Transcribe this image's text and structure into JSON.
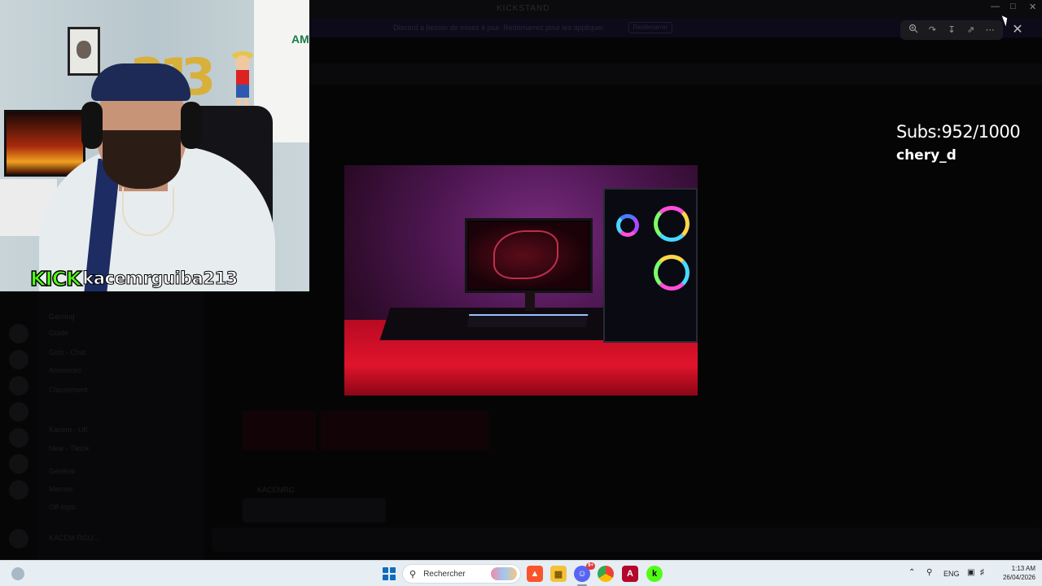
{
  "background_app": {
    "title": "KICKSTAND",
    "banner_text": "Discord a besoin de mises à jour. Redémarrez pour les appliquer.",
    "banner_button": "Redémarrer",
    "sidebar_rows": [
      "Gaming",
      "Guide",
      "Girls - Chat",
      "Annonces",
      "Classement",
      "Kacem - UK",
      "New - Tiktok",
      "Général",
      "Memes",
      "Off-topic"
    ],
    "user_tag": "KACEM RGU...",
    "message_author": "KACEMRG"
  },
  "webcam": {
    "platform_logo": "KICK",
    "username": "kacemrguiba213",
    "shirt_text": "AMA",
    "balloons": [
      "2",
      "1",
      "3"
    ]
  },
  "viewer": {
    "toolbar_icons": [
      "zoom-in-icon",
      "share-icon",
      "download-icon",
      "open-external-icon",
      "more-icon"
    ],
    "close_icon": "close-icon"
  },
  "overlay": {
    "subs": "Subs:952/1000",
    "user": "chery_d"
  },
  "taskbar": {
    "search_placeholder": "Rechercher",
    "discord_badge": "9+",
    "language": "ENG",
    "time": "1:13 AM",
    "date": "26/04/2026"
  },
  "colors": {
    "kick_green": "#53fc18",
    "windows_blue": "#0f6cbd",
    "taskbar_bg": "#e7eef3"
  }
}
